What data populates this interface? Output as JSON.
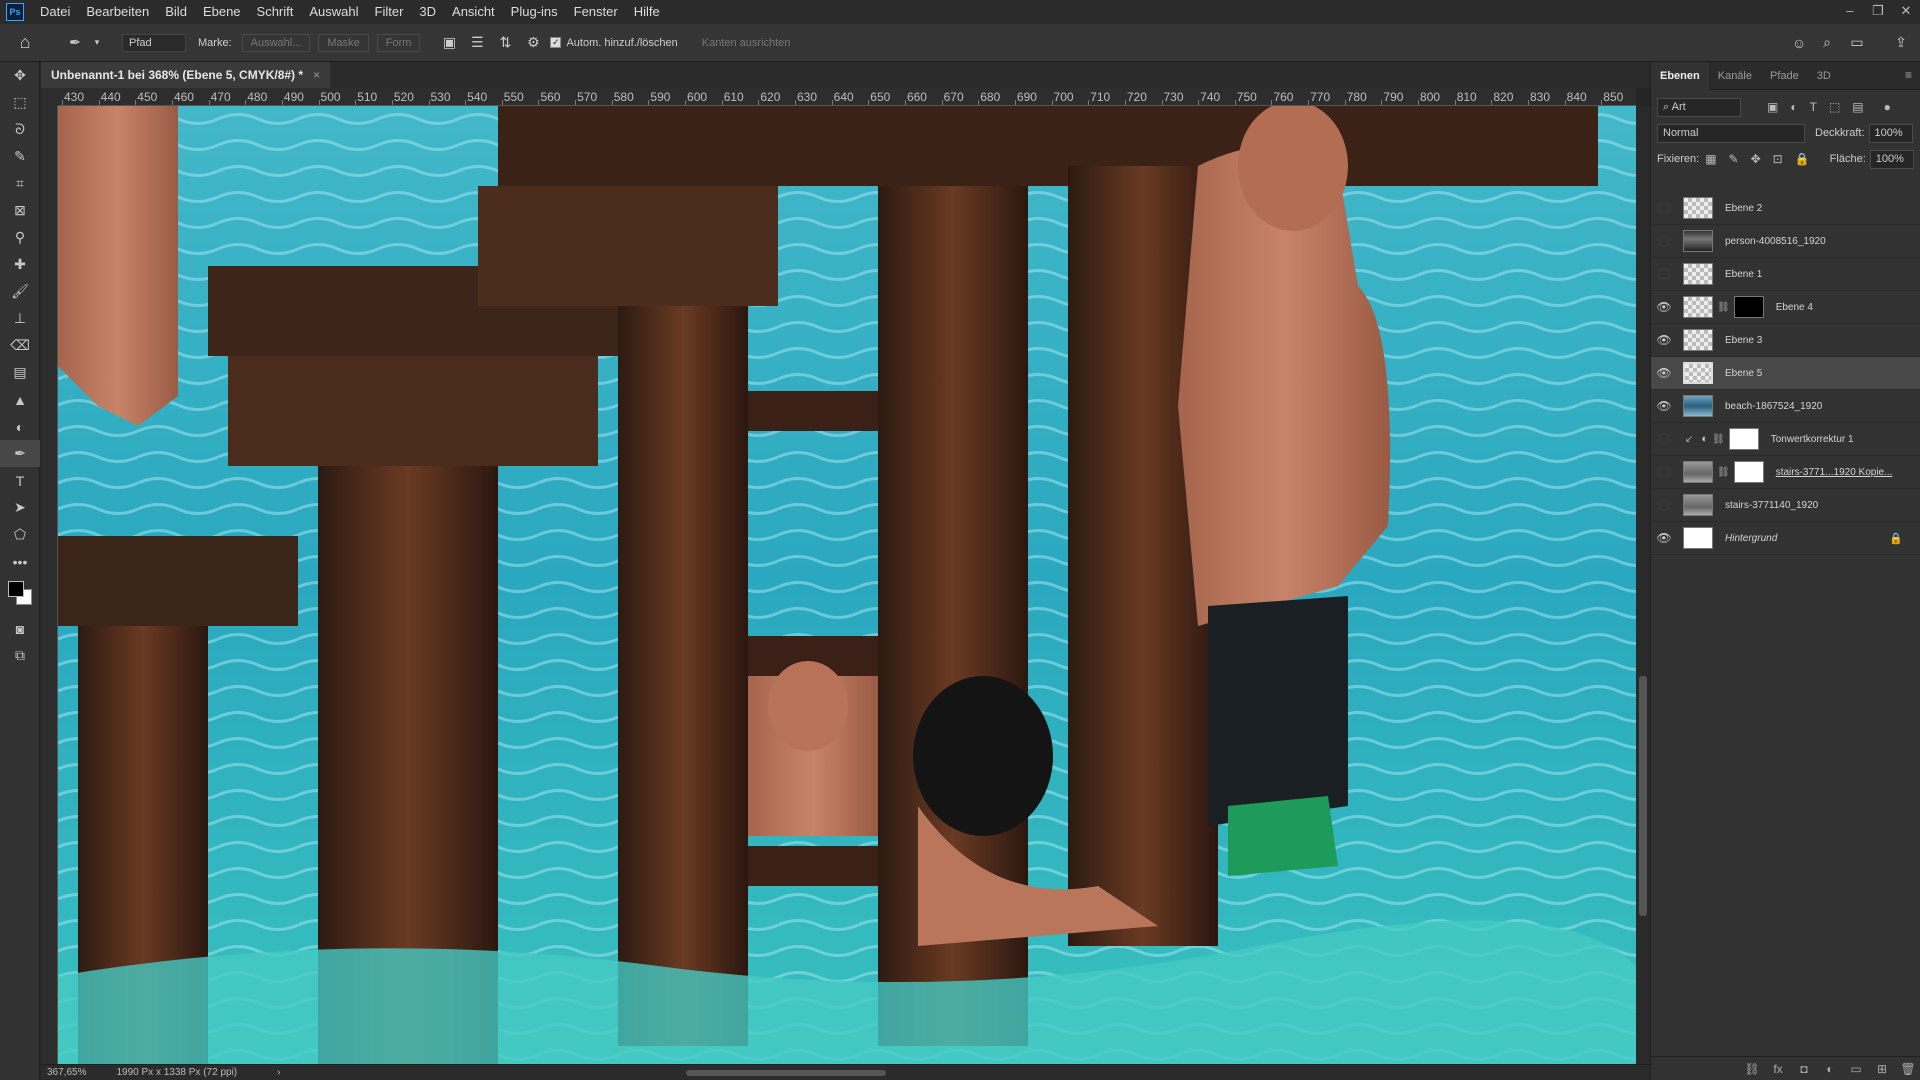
{
  "app": {
    "logo": "Ps"
  },
  "menu": [
    "Datei",
    "Bearbeiten",
    "Bild",
    "Ebene",
    "Schrift",
    "Auswahl",
    "Filter",
    "3D",
    "Ansicht",
    "Plug-ins",
    "Fenster",
    "Hilfe"
  ],
  "options": {
    "mode_value": "Pfad",
    "marke_label": "Marke:",
    "auswahl_btn": "Auswahl...",
    "maske_btn": "Maske",
    "form_btn": "Form",
    "auto_add_label": "Autom. hinzuf./löschen",
    "kanten_label": "Kanten ausrichten"
  },
  "document": {
    "tab_title": "Unbenannt-1 bei 368% (Ebene 5, CMYK/8#) *",
    "close": "×"
  },
  "ruler": {
    "labels": [
      "430",
      "440",
      "450",
      "460",
      "470",
      "480",
      "490",
      "500",
      "510",
      "520",
      "530",
      "540",
      "550",
      "560",
      "570",
      "580",
      "590",
      "600",
      "610",
      "620",
      "630",
      "640",
      "650",
      "660",
      "670",
      "680",
      "690",
      "700",
      "710",
      "720",
      "730",
      "740",
      "750",
      "760",
      "770",
      "780",
      "790",
      "800",
      "810",
      "820",
      "830",
      "840",
      "850"
    ]
  },
  "status": {
    "zoom": "367,65%",
    "doc_size": "1990 Px x 1338 Px (72 ppi)",
    "arrow": "›"
  },
  "panel": {
    "tabs": [
      "Ebenen",
      "Kanäle",
      "Pfade",
      "3D"
    ],
    "filter_label": "Art",
    "blend_mode": "Normal",
    "opacity_label": "Deckkraft:",
    "opacity_value": "100%",
    "lock_label": "Fixieren:",
    "fill_label": "Fläche:",
    "fill_value": "100%"
  },
  "layers": [
    {
      "name": "Ebene 2",
      "visible": false
    },
    {
      "name": "person-4008516_1920",
      "visible": false
    },
    {
      "name": "Ebene 1",
      "visible": false
    },
    {
      "name": "Ebene 4",
      "visible": true
    },
    {
      "name": "Ebene 3",
      "visible": true
    },
    {
      "name": "Ebene 5",
      "visible": true,
      "selected": true
    },
    {
      "name": "beach-1867524_1920",
      "visible": true
    },
    {
      "name": "Tonwertkorrektur 1",
      "visible": false
    },
    {
      "name": "stairs-3771...1920 Kopie...",
      "visible": false
    },
    {
      "name": "stairs-3771140_1920",
      "visible": false
    },
    {
      "name": "Hintergrund",
      "visible": true
    }
  ],
  "icons": {
    "eye": "👁",
    "lock": "🔒",
    "home": "⌂",
    "pen": "✒"
  },
  "colors": {
    "accent": "#31a8ff",
    "water": "#3cb7c9",
    "rust": "#5a2f1c"
  }
}
